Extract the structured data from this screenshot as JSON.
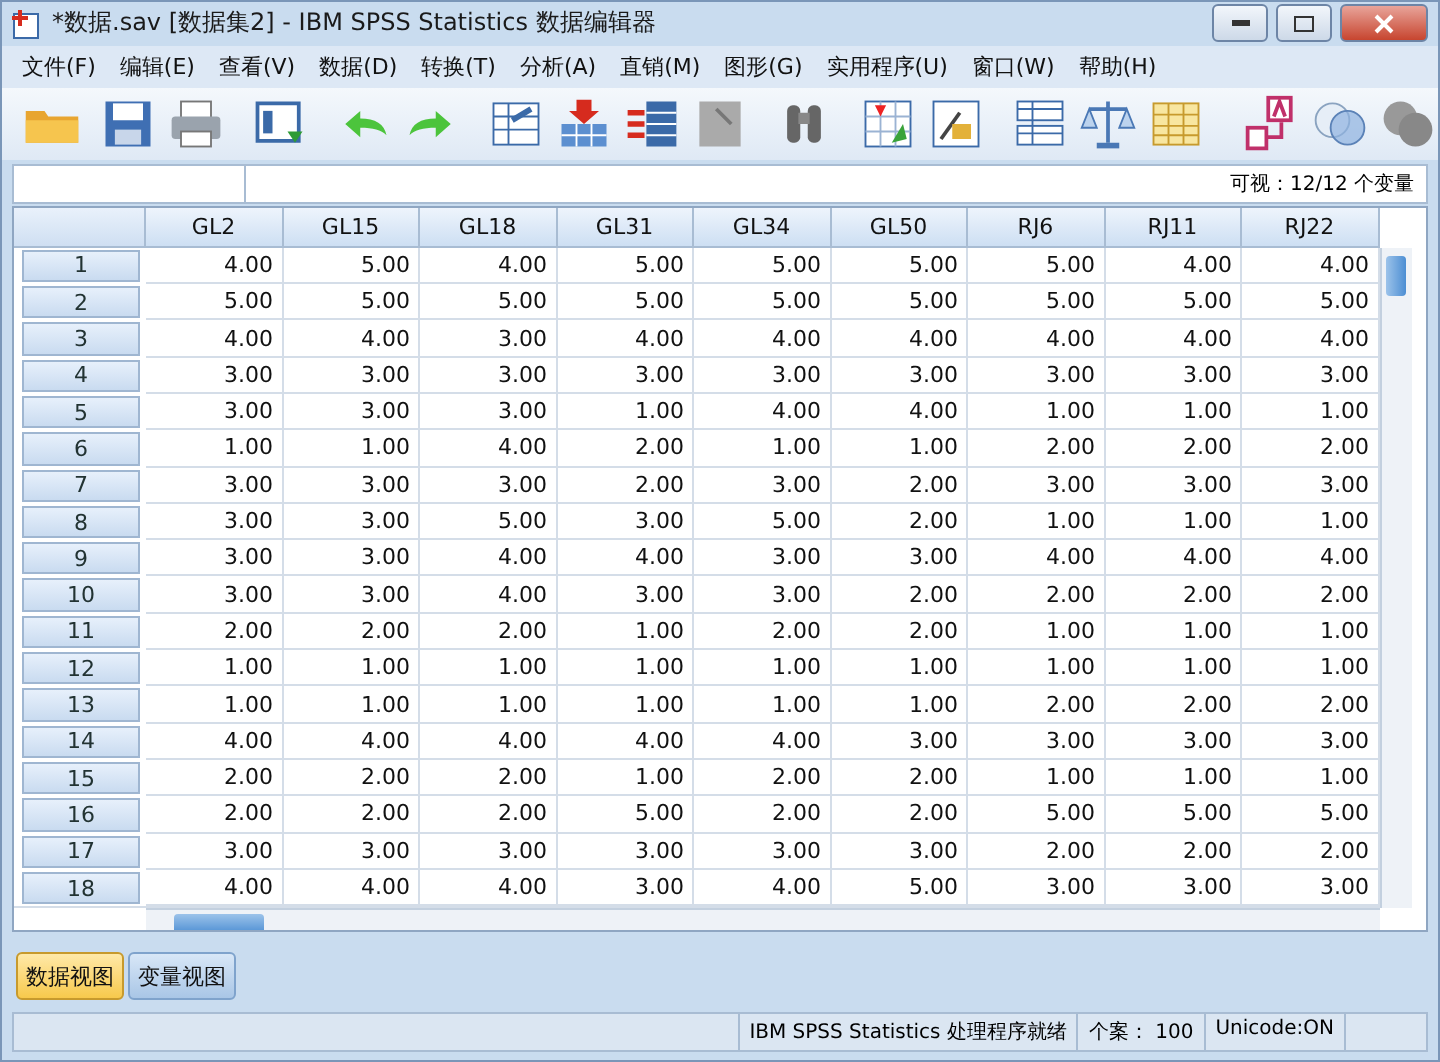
{
  "window": {
    "title": "*数据.sav [数据集2] - IBM SPSS Statistics 数据编辑器"
  },
  "menu": [
    "文件(F)",
    "编辑(E)",
    "查看(V)",
    "数据(D)",
    "转换(T)",
    "分析(A)",
    "直销(M)",
    "图形(G)",
    "实用程序(U)",
    "窗口(W)",
    "帮助(H)"
  ],
  "visible_vars": "可视：12/12 个变量",
  "table": {
    "columns": [
      "GL2",
      "GL15",
      "GL18",
      "GL31",
      "GL34",
      "GL50",
      "RJ6",
      "RJ11",
      "RJ22"
    ],
    "rows": [
      {
        "label": "1",
        "cells": [
          "4.00",
          "5.00",
          "4.00",
          "5.00",
          "5.00",
          "5.00",
          "5.00",
          "4.00",
          "4.00"
        ]
      },
      {
        "label": "2",
        "cells": [
          "5.00",
          "5.00",
          "5.00",
          "5.00",
          "5.00",
          "5.00",
          "5.00",
          "5.00",
          "5.00"
        ]
      },
      {
        "label": "3",
        "cells": [
          "4.00",
          "4.00",
          "3.00",
          "4.00",
          "4.00",
          "4.00",
          "4.00",
          "4.00",
          "4.00"
        ]
      },
      {
        "label": "4",
        "cells": [
          "3.00",
          "3.00",
          "3.00",
          "3.00",
          "3.00",
          "3.00",
          "3.00",
          "3.00",
          "3.00"
        ]
      },
      {
        "label": "5",
        "cells": [
          "3.00",
          "3.00",
          "3.00",
          "1.00",
          "4.00",
          "4.00",
          "1.00",
          "1.00",
          "1.00"
        ]
      },
      {
        "label": "6",
        "cells": [
          "1.00",
          "1.00",
          "4.00",
          "2.00",
          "1.00",
          "1.00",
          "2.00",
          "2.00",
          "2.00"
        ]
      },
      {
        "label": "7",
        "cells": [
          "3.00",
          "3.00",
          "3.00",
          "2.00",
          "3.00",
          "2.00",
          "3.00",
          "3.00",
          "3.00"
        ]
      },
      {
        "label": "8",
        "cells": [
          "3.00",
          "3.00",
          "5.00",
          "3.00",
          "5.00",
          "2.00",
          "1.00",
          "1.00",
          "1.00"
        ]
      },
      {
        "label": "9",
        "cells": [
          "3.00",
          "3.00",
          "4.00",
          "4.00",
          "3.00",
          "3.00",
          "4.00",
          "4.00",
          "4.00"
        ]
      },
      {
        "label": "10",
        "cells": [
          "3.00",
          "3.00",
          "4.00",
          "3.00",
          "3.00",
          "2.00",
          "2.00",
          "2.00",
          "2.00"
        ]
      },
      {
        "label": "11",
        "cells": [
          "2.00",
          "2.00",
          "2.00",
          "1.00",
          "2.00",
          "2.00",
          "1.00",
          "1.00",
          "1.00"
        ]
      },
      {
        "label": "12",
        "cells": [
          "1.00",
          "1.00",
          "1.00",
          "1.00",
          "1.00",
          "1.00",
          "1.00",
          "1.00",
          "1.00"
        ]
      },
      {
        "label": "13",
        "cells": [
          "1.00",
          "1.00",
          "1.00",
          "1.00",
          "1.00",
          "1.00",
          "2.00",
          "2.00",
          "2.00"
        ]
      },
      {
        "label": "14",
        "cells": [
          "4.00",
          "4.00",
          "4.00",
          "4.00",
          "4.00",
          "3.00",
          "3.00",
          "3.00",
          "3.00"
        ]
      },
      {
        "label": "15",
        "cells": [
          "2.00",
          "2.00",
          "2.00",
          "1.00",
          "2.00",
          "2.00",
          "1.00",
          "1.00",
          "1.00"
        ]
      },
      {
        "label": "16",
        "cells": [
          "2.00",
          "2.00",
          "2.00",
          "5.00",
          "2.00",
          "2.00",
          "5.00",
          "5.00",
          "5.00"
        ]
      },
      {
        "label": "17",
        "cells": [
          "3.00",
          "3.00",
          "3.00",
          "3.00",
          "3.00",
          "3.00",
          "2.00",
          "2.00",
          "2.00"
        ]
      },
      {
        "label": "18",
        "cells": [
          "4.00",
          "4.00",
          "4.00",
          "3.00",
          "4.00",
          "5.00",
          "3.00",
          "3.00",
          "3.00"
        ]
      }
    ]
  },
  "tabs": [
    {
      "label": "数据视图",
      "selected": true
    },
    {
      "label": "变量视图",
      "selected": false
    }
  ],
  "status_bar": {
    "processor": "IBM SPSS Statistics 处理程序就绪",
    "cases": "个案： 100",
    "unicode": "Unicode:ON"
  }
}
